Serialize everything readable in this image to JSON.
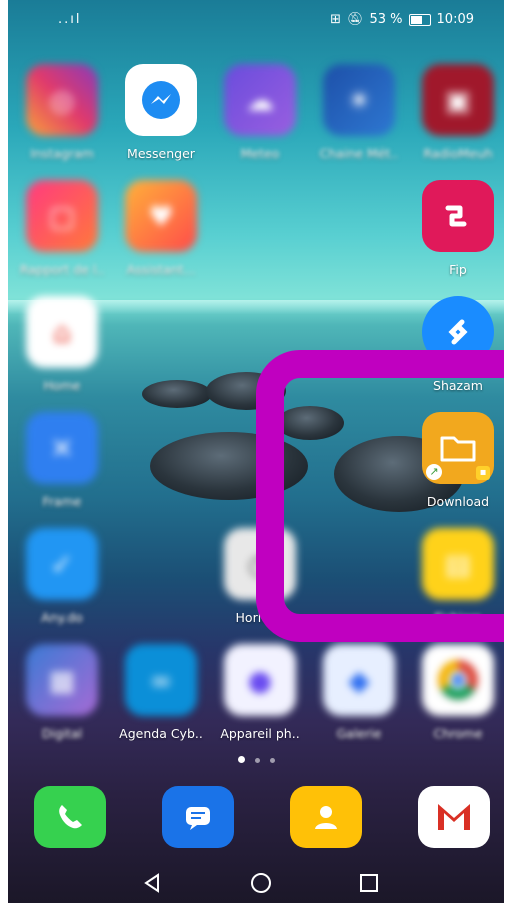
{
  "status": {
    "signal": "..ıl",
    "battery_text": "53 %",
    "time": "10:09"
  },
  "apps": {
    "instagram": {
      "label": "Instagram"
    },
    "messenger": {
      "label": "Messenger"
    },
    "meteo": {
      "label": "Meteo"
    },
    "chaine_meteo": {
      "label": "Chaine Mét.."
    },
    "radio": {
      "label": "RadioMeuh"
    },
    "rapport": {
      "label": "Rapport de l.."
    },
    "assistant": {
      "label": "Assistant..."
    },
    "fip": {
      "label": "Fip"
    },
    "home": {
      "label": "Home"
    },
    "shazam": {
      "label": "Shazam"
    },
    "frame": {
      "label": "Frame"
    },
    "download": {
      "label": "Download"
    },
    "anydo": {
      "label": "Any.do"
    },
    "horloge": {
      "label": "Horloge"
    },
    "fichiers": {
      "label": "Fichiers"
    },
    "digital": {
      "label": "Digital"
    },
    "agenda": {
      "label": "Agenda Cyb.."
    },
    "appareil": {
      "label": "Appareil ph.."
    },
    "galerie": {
      "label": "Galerie"
    },
    "chrome": {
      "label": "Chrome"
    }
  },
  "page_indicator": {
    "count": 3,
    "current": 1
  },
  "colors": {
    "highlight": "#c000c0"
  }
}
